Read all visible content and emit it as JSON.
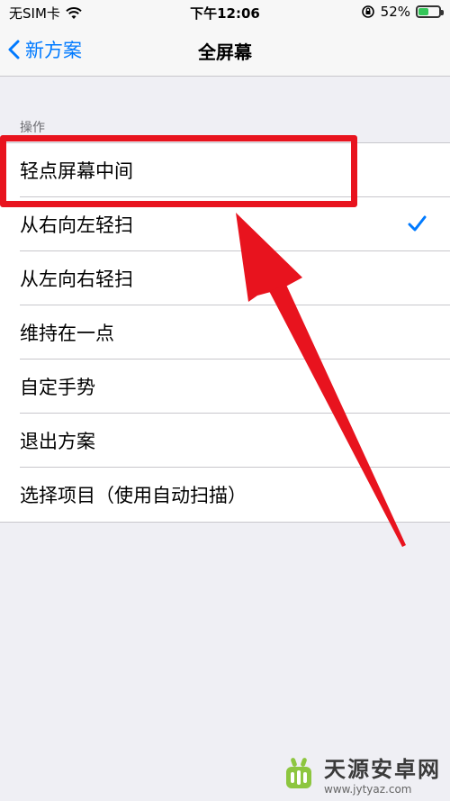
{
  "status_bar": {
    "carrier": "无SIM卡",
    "time": "下午12:06",
    "battery_percent": "52%",
    "battery_level": 0.52,
    "icons": [
      "wifi-icon",
      "orientation-lock-icon",
      "battery-icon"
    ]
  },
  "nav": {
    "back_label": "新方案",
    "title": "全屏幕"
  },
  "section": {
    "header": "操作"
  },
  "items": [
    {
      "label": "轻点屏幕中间",
      "checked": false
    },
    {
      "label": "从右向左轻扫",
      "checked": true
    },
    {
      "label": "从左向右轻扫",
      "checked": false
    },
    {
      "label": "维持在一点",
      "checked": false
    },
    {
      "label": "自定手势",
      "checked": false
    },
    {
      "label": "退出方案",
      "checked": false
    },
    {
      "label": "选择项目（使用自动扫描）",
      "checked": false
    }
  ],
  "colors": {
    "accent": "#007aff",
    "annotation": "#e8131e",
    "background": "#efeff4"
  },
  "watermark": {
    "title": "天源安卓网",
    "url": "www.jytyaz.com"
  }
}
